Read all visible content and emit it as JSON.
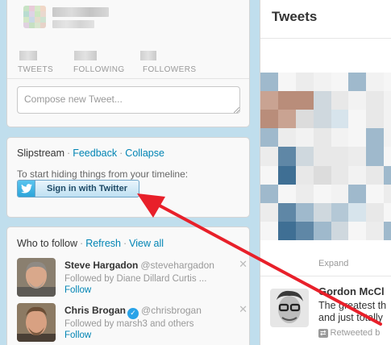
{
  "profile": {
    "stats": [
      {
        "label": "TWEETS"
      },
      {
        "label": "FOLLOWING"
      },
      {
        "label": "FOLLOWERS"
      }
    ],
    "compose_placeholder": "Compose new Tweet..."
  },
  "slipstream": {
    "title": "Slipstream",
    "separator": "·",
    "feedback_link": "Feedback",
    "collapse_link": "Collapse",
    "hint": "To start hiding things from your timeline:",
    "signin_label": "Sign in with Twitter"
  },
  "who_to_follow": {
    "title": "Who to follow",
    "separator": "·",
    "refresh_link": "Refresh",
    "view_all_link": "View all",
    "items": [
      {
        "name": "Steve Hargadon",
        "handle": "@stevehargadon",
        "subtext": "Followed by Diane Dillard Curtis ...",
        "follow_label": "Follow",
        "close": "✕",
        "verified": false
      },
      {
        "name": "Chris Brogan",
        "handle": "@chrisbrogan",
        "subtext": "Followed by marsh3 and others",
        "follow_label": "Follow",
        "close": "✕",
        "verified": true
      }
    ]
  },
  "tweets": {
    "title": "Tweets",
    "expand_label": "Expand",
    "tweet": {
      "author": "Gordon McCl",
      "text_line1": "The greatest th",
      "text_line2": "and just totally",
      "retweet_label": "Retweeted b"
    }
  },
  "colors": {
    "background": "#c0deed",
    "link": "#0084b4",
    "arrow": "#e8202a"
  },
  "icons": {
    "signin": "twitter-bird-icon",
    "retweet": "retweet-icon",
    "verified": "verified-badge-icon",
    "close": "close-icon"
  }
}
